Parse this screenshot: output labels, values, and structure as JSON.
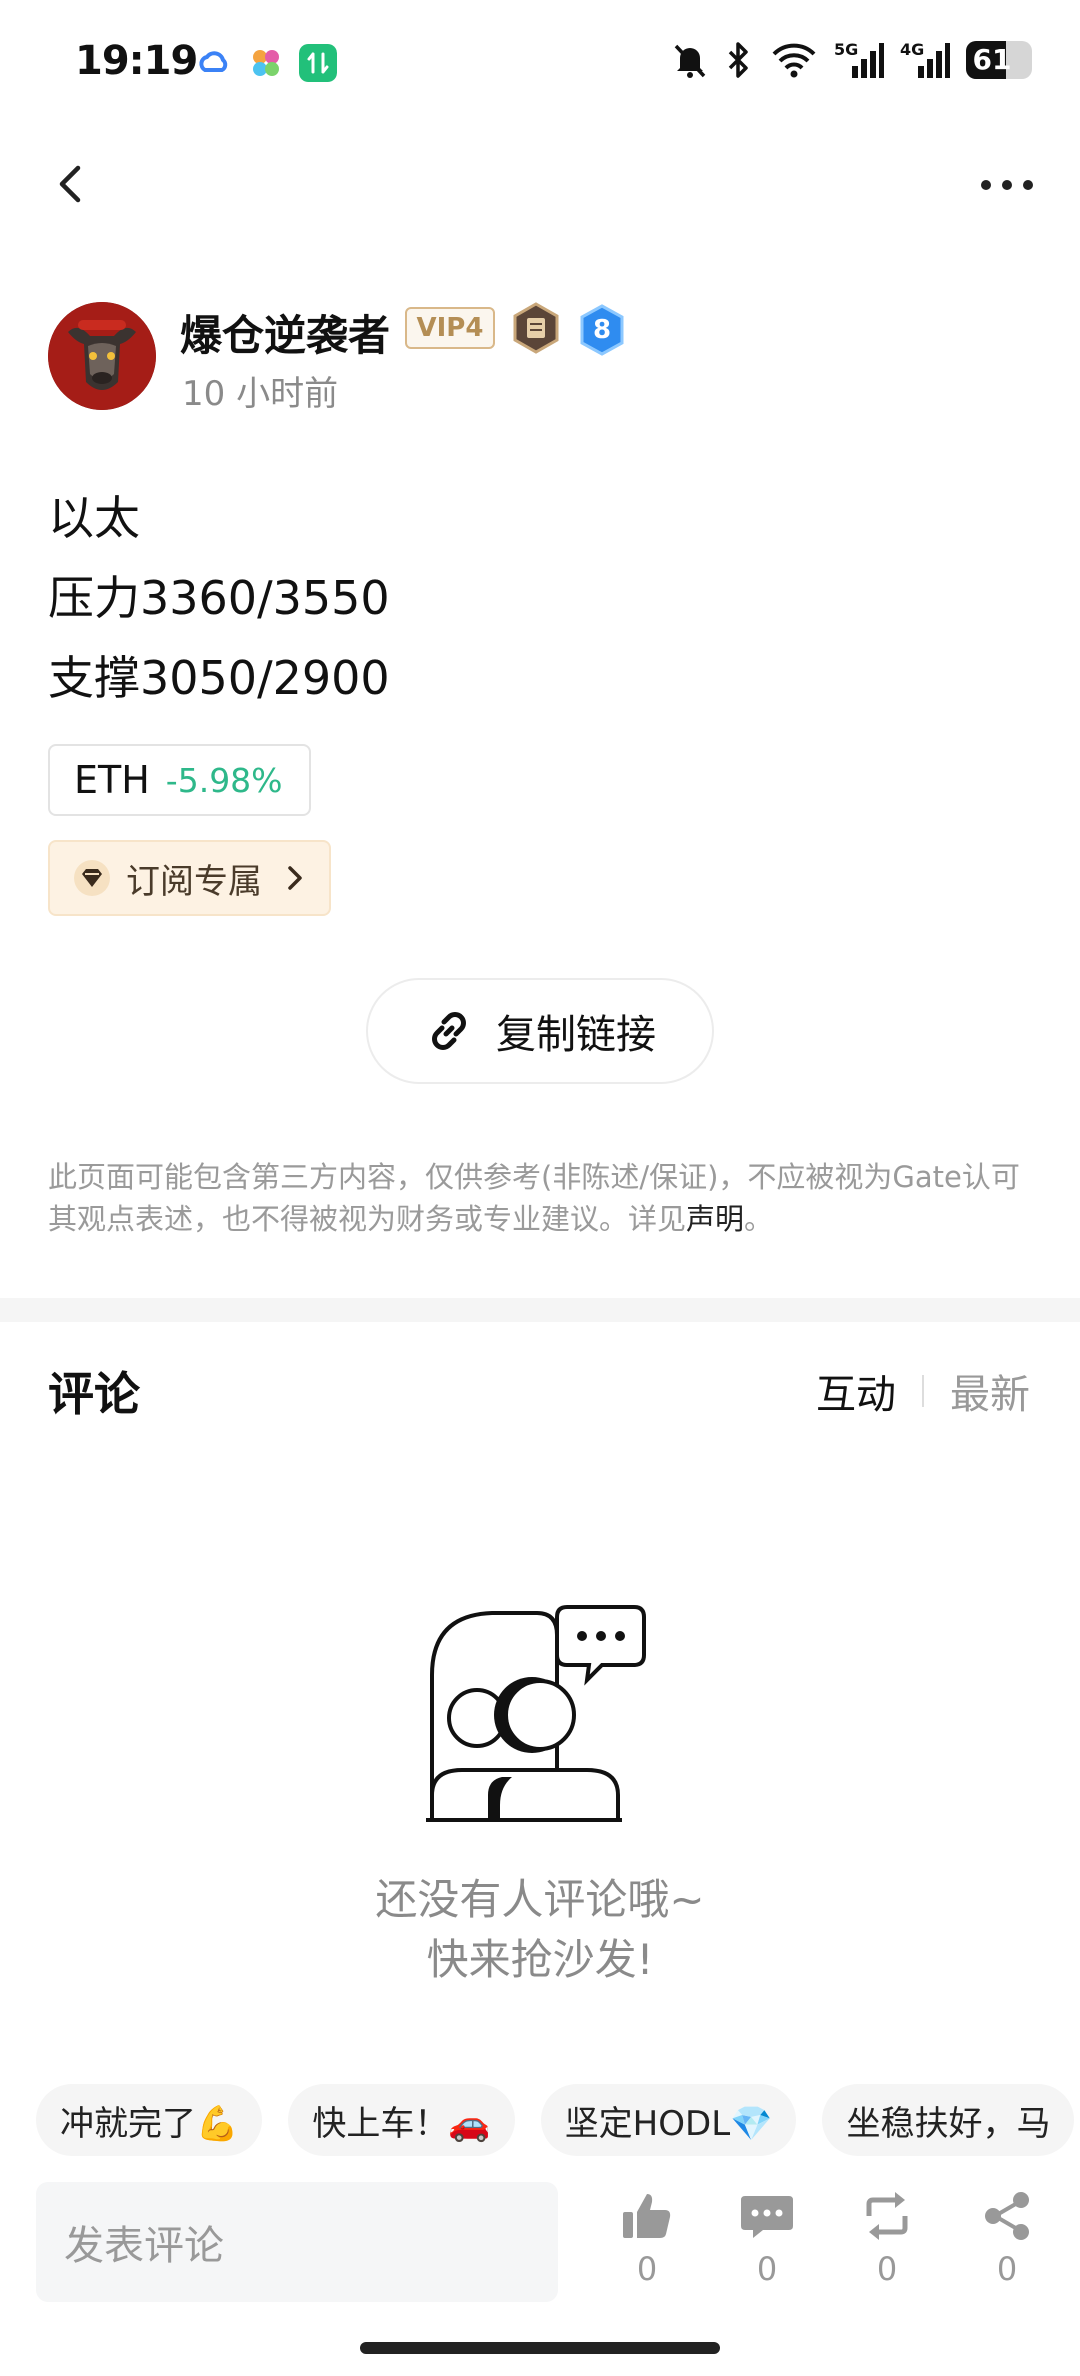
{
  "status_bar": {
    "time": "19:19",
    "battery": "61",
    "battery_level_percent": 61,
    "network_5g": "5G",
    "network_4g": "4G"
  },
  "author": {
    "name": "爆仓逆袭者",
    "vip_badge": "VIP4",
    "level": "8",
    "post_time": "10 小时前"
  },
  "post": {
    "lines": [
      "以太",
      "压力3360/3550",
      "支撑3050/2900"
    ]
  },
  "ticker": {
    "symbol": "ETH",
    "change": "-5.98%"
  },
  "subscribe": {
    "label": "订阅专属"
  },
  "copy_link": {
    "label": "复制链接"
  },
  "disclaimer": {
    "text": "此页面可能包含第三方内容，仅供参考(非陈述/保证)，不应被视为Gate认可其观点表述，也不得被视为财务或专业建议。详见",
    "link": "声明",
    "suffix": "。"
  },
  "comments": {
    "title": "评论",
    "sort_tabs": [
      "互动",
      "最新"
    ],
    "empty_line1": "还没有人评论哦~",
    "empty_line2": "快来抢沙发!"
  },
  "quick_replies": [
    "冲就完了💪",
    "快上车！🚗",
    "坚定HODL💎",
    "坐稳扶好，马"
  ],
  "bottom_bar": {
    "input_placeholder": "发表评论",
    "like_count": "0",
    "comment_count": "0",
    "repost_count": "0",
    "share_count": "0"
  },
  "colors": {
    "ticker_green": "#2eb88a",
    "vip_gold": "#b48e55",
    "level_blue": "#2f8cf0"
  }
}
